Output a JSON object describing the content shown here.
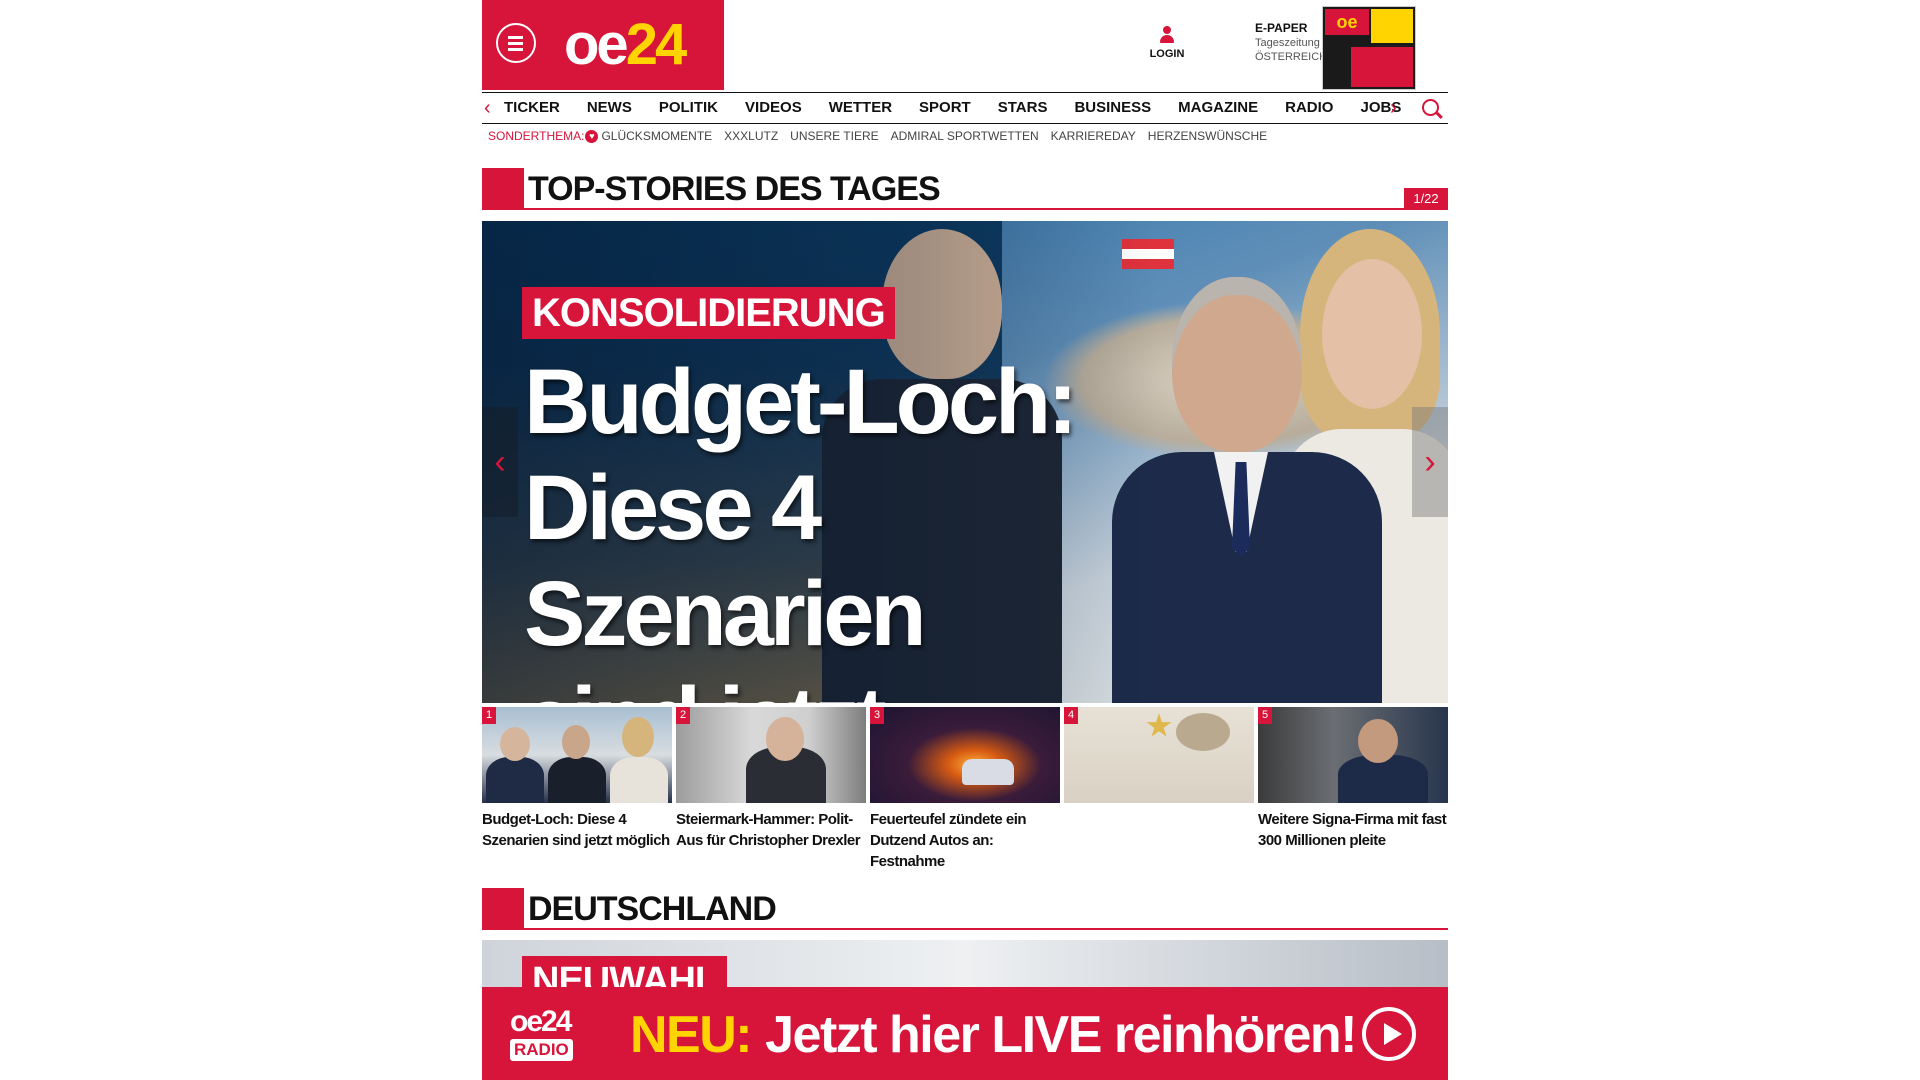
{
  "header": {
    "logo_main": "oe",
    "logo_num": "24",
    "login_label": "LOGIN",
    "epaper_title": "E-PAPER",
    "epaper_sub1": "Tageszeitung",
    "epaper_sub2": "ÖSTERREICH"
  },
  "nav": {
    "items": [
      "TICKER",
      "NEWS",
      "POLITIK",
      "VIDEOS",
      "WETTER",
      "SPORT",
      "STARS",
      "BUSINESS",
      "MAGAZINE",
      "RADIO",
      "JOBS"
    ]
  },
  "subnav": {
    "label": "SONDERTHEMA:",
    "items": [
      "GLÜCKSMOMENTE",
      "XXXLUTZ",
      "UNSERE TIERE",
      "ADMIRAL SPORTWETTEN",
      "KARRIEREDAY",
      "HERZENSWÜNSCHE"
    ]
  },
  "top_stories": {
    "title": "TOP-STORIES DES TAGES",
    "counter": "1/22",
    "hero": {
      "kicker": "KONSOLIDIERUNG",
      "headline_line1": "Budget-Loch:",
      "headline_line2": "Diese 4 Szenarien",
      "headline_line3": "sind jetzt möglich"
    },
    "thumbs": [
      {
        "n": "1",
        "caption": "Budget-Loch: Diese 4 Szenarien sind jetzt möglich"
      },
      {
        "n": "2",
        "caption": "Steiermark-Hammer: Polit-Aus für Christopher Drexler"
      },
      {
        "n": "3",
        "caption": "Feuerteufel zündete ein Dutzend Autos an: Festnahme"
      },
      {
        "n": "4",
        "caption": ""
      },
      {
        "n": "5",
        "caption": "Weitere Signa-Firma mit fast 300 Millionen pleite"
      }
    ]
  },
  "section2": {
    "title": "DEUTSCHLAND",
    "kicker": "NEUWAHL"
  },
  "radio_banner": {
    "logo_main": "oe24",
    "logo_sub": "RADIO",
    "neu": "NEU:",
    "text": "Jetzt hier LIVE reinhören!"
  },
  "colors": {
    "brand_red": "#d7143a",
    "brand_yellow": "#ffd400"
  },
  "icons": [
    "hamburger-menu-icon",
    "user-icon",
    "search-icon",
    "chevron-left-icon",
    "chevron-right-icon",
    "heart-icon",
    "play-icon"
  ]
}
